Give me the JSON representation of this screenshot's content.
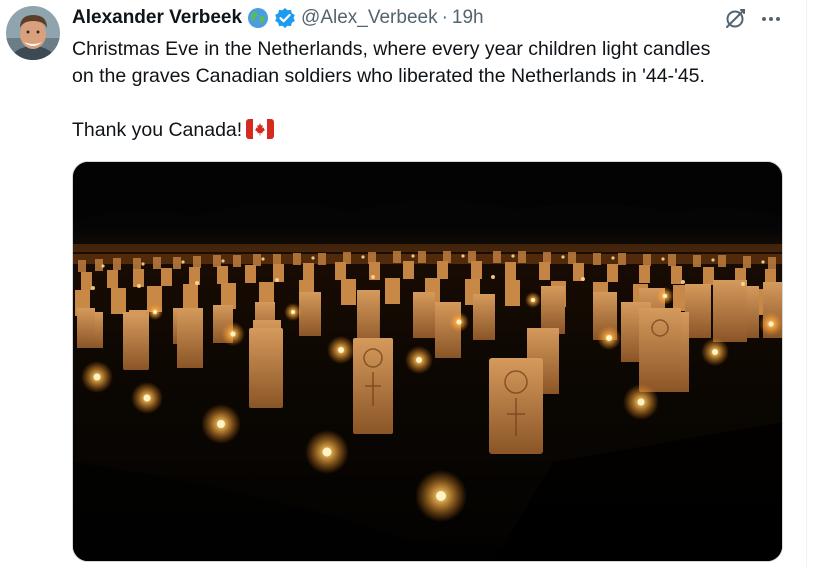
{
  "tweet": {
    "author": {
      "display_name": "Alexander Verbeek",
      "handle": "@Alex_Verbeek",
      "avatar_icon": "avatar-photo",
      "badges": [
        "globe-earth-icon",
        "verified-badge-icon"
      ],
      "verified_color": "#1d9bf0"
    },
    "separator": "·",
    "timestamp": "19h",
    "text": {
      "line1": "Christmas Eve in the Netherlands, where every year children light candles",
      "line2": "on the graves Canadian soldiers who liberated the Netherlands in '44-'45.",
      "line3": "Thank you Canada!",
      "emoji": "canada-flag-icon"
    },
    "media": {
      "type": "photo",
      "subject": "war-cemetery-candlelit-graves"
    },
    "actions": {
      "grok_icon": "grok-icon",
      "more_icon": "more-options-icon"
    }
  }
}
